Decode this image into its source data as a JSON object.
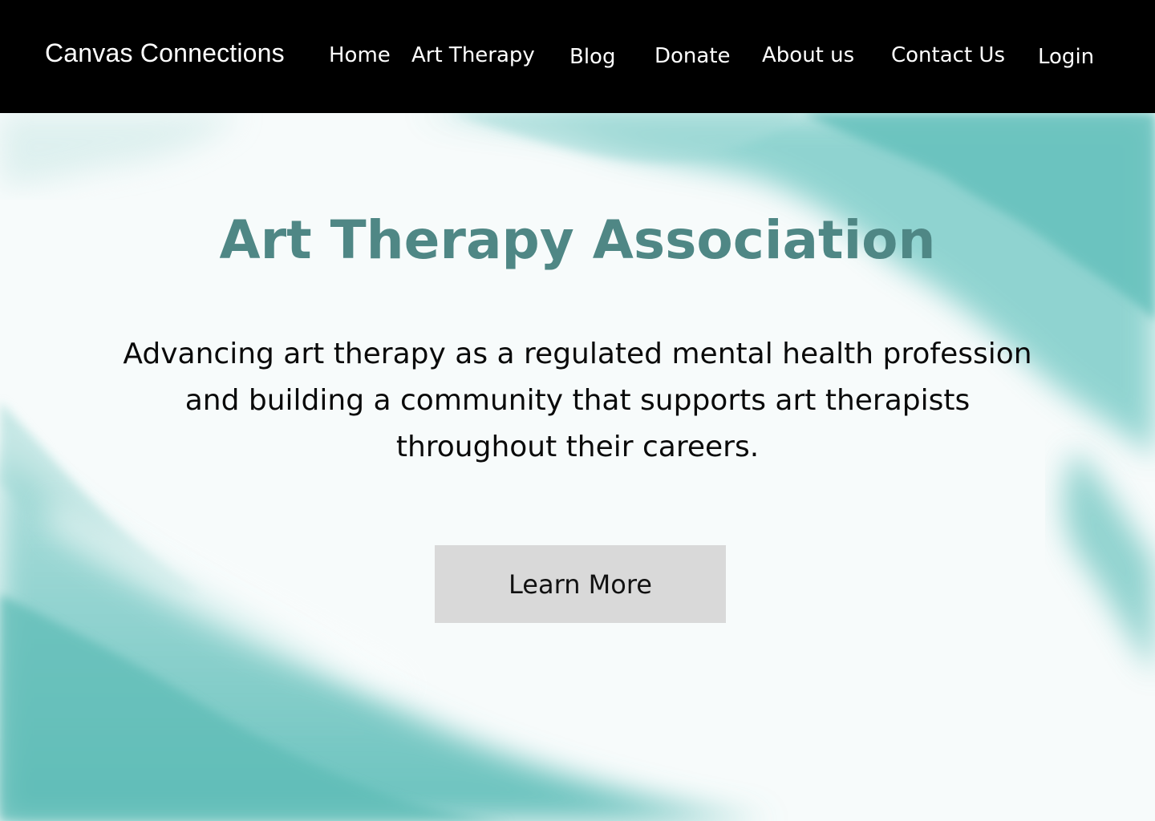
{
  "header": {
    "brand": "Canvas Connections",
    "nav": {
      "home": "Home",
      "art_therapy": "Art Therapy",
      "blog": "Blog",
      "donate": "Donate",
      "about": "About us",
      "contact": "Contact Us",
      "login": "Login"
    }
  },
  "hero": {
    "title": "Art Therapy Association",
    "tagline": "Advancing art therapy as a regulated mental health profession and building a community that supports art therapists throughout their careers.",
    "cta_label": "Learn More"
  },
  "colors": {
    "header_bg": "#000000",
    "title": "#4f8785",
    "accent_teal": "#6fc3bf",
    "button_bg": "#d9d9d9"
  }
}
